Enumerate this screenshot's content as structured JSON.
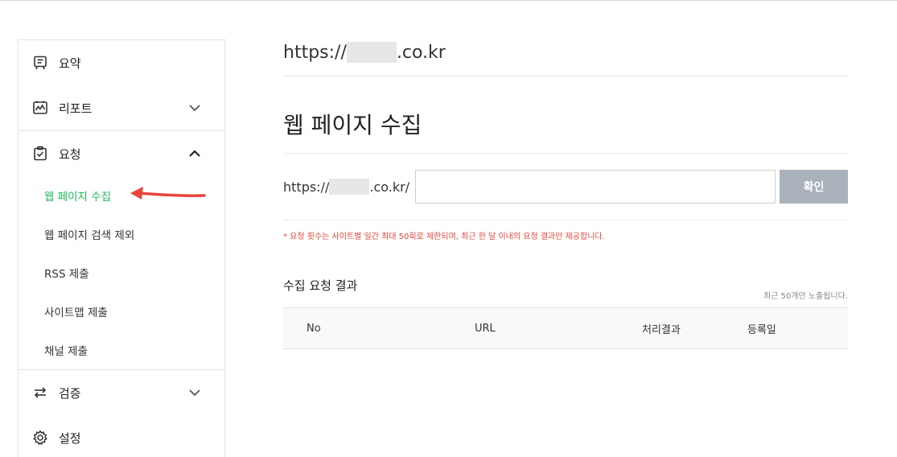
{
  "sidebar": {
    "items": [
      {
        "label": "요약",
        "icon": "summary-icon"
      },
      {
        "label": "리포트",
        "icon": "report-icon",
        "expanded": false
      },
      {
        "label": "요청",
        "icon": "request-icon",
        "expanded": true
      },
      {
        "label": "검증",
        "icon": "verify-icon",
        "expanded": false
      },
      {
        "label": "설정",
        "icon": "gear-icon"
      }
    ],
    "request_subitems": [
      {
        "label": "웹 페이지 수집",
        "active": true
      },
      {
        "label": "웹 페이지 검색 제외"
      },
      {
        "label": "RSS 제출"
      },
      {
        "label": "사이트맵 제출"
      },
      {
        "label": "채널 제출"
      }
    ]
  },
  "main": {
    "domain_prefix": "https://",
    "domain_suffix": ".co.kr",
    "page_title": "웹 페이지 수집",
    "form": {
      "url_prefix": "https://",
      "url_suffix": ".co.kr/",
      "input_value": "",
      "confirm_label": "확인"
    },
    "notice": "* 요청 횟수는 사이트별 일간 최대 50회로 제한되며, 최근 한 달 이내의 요청 결과만 제공합니다.",
    "results": {
      "title": "수집 요청 결과",
      "note": "최근 50개만 노출됩니다.",
      "columns": [
        "No",
        "URL",
        "처리결과",
        "등록일"
      ]
    }
  },
  "colors": {
    "active": "#1fb95a",
    "notice": "#e2463b",
    "button": "#a9b1bb",
    "arrow": "#e8453c"
  }
}
